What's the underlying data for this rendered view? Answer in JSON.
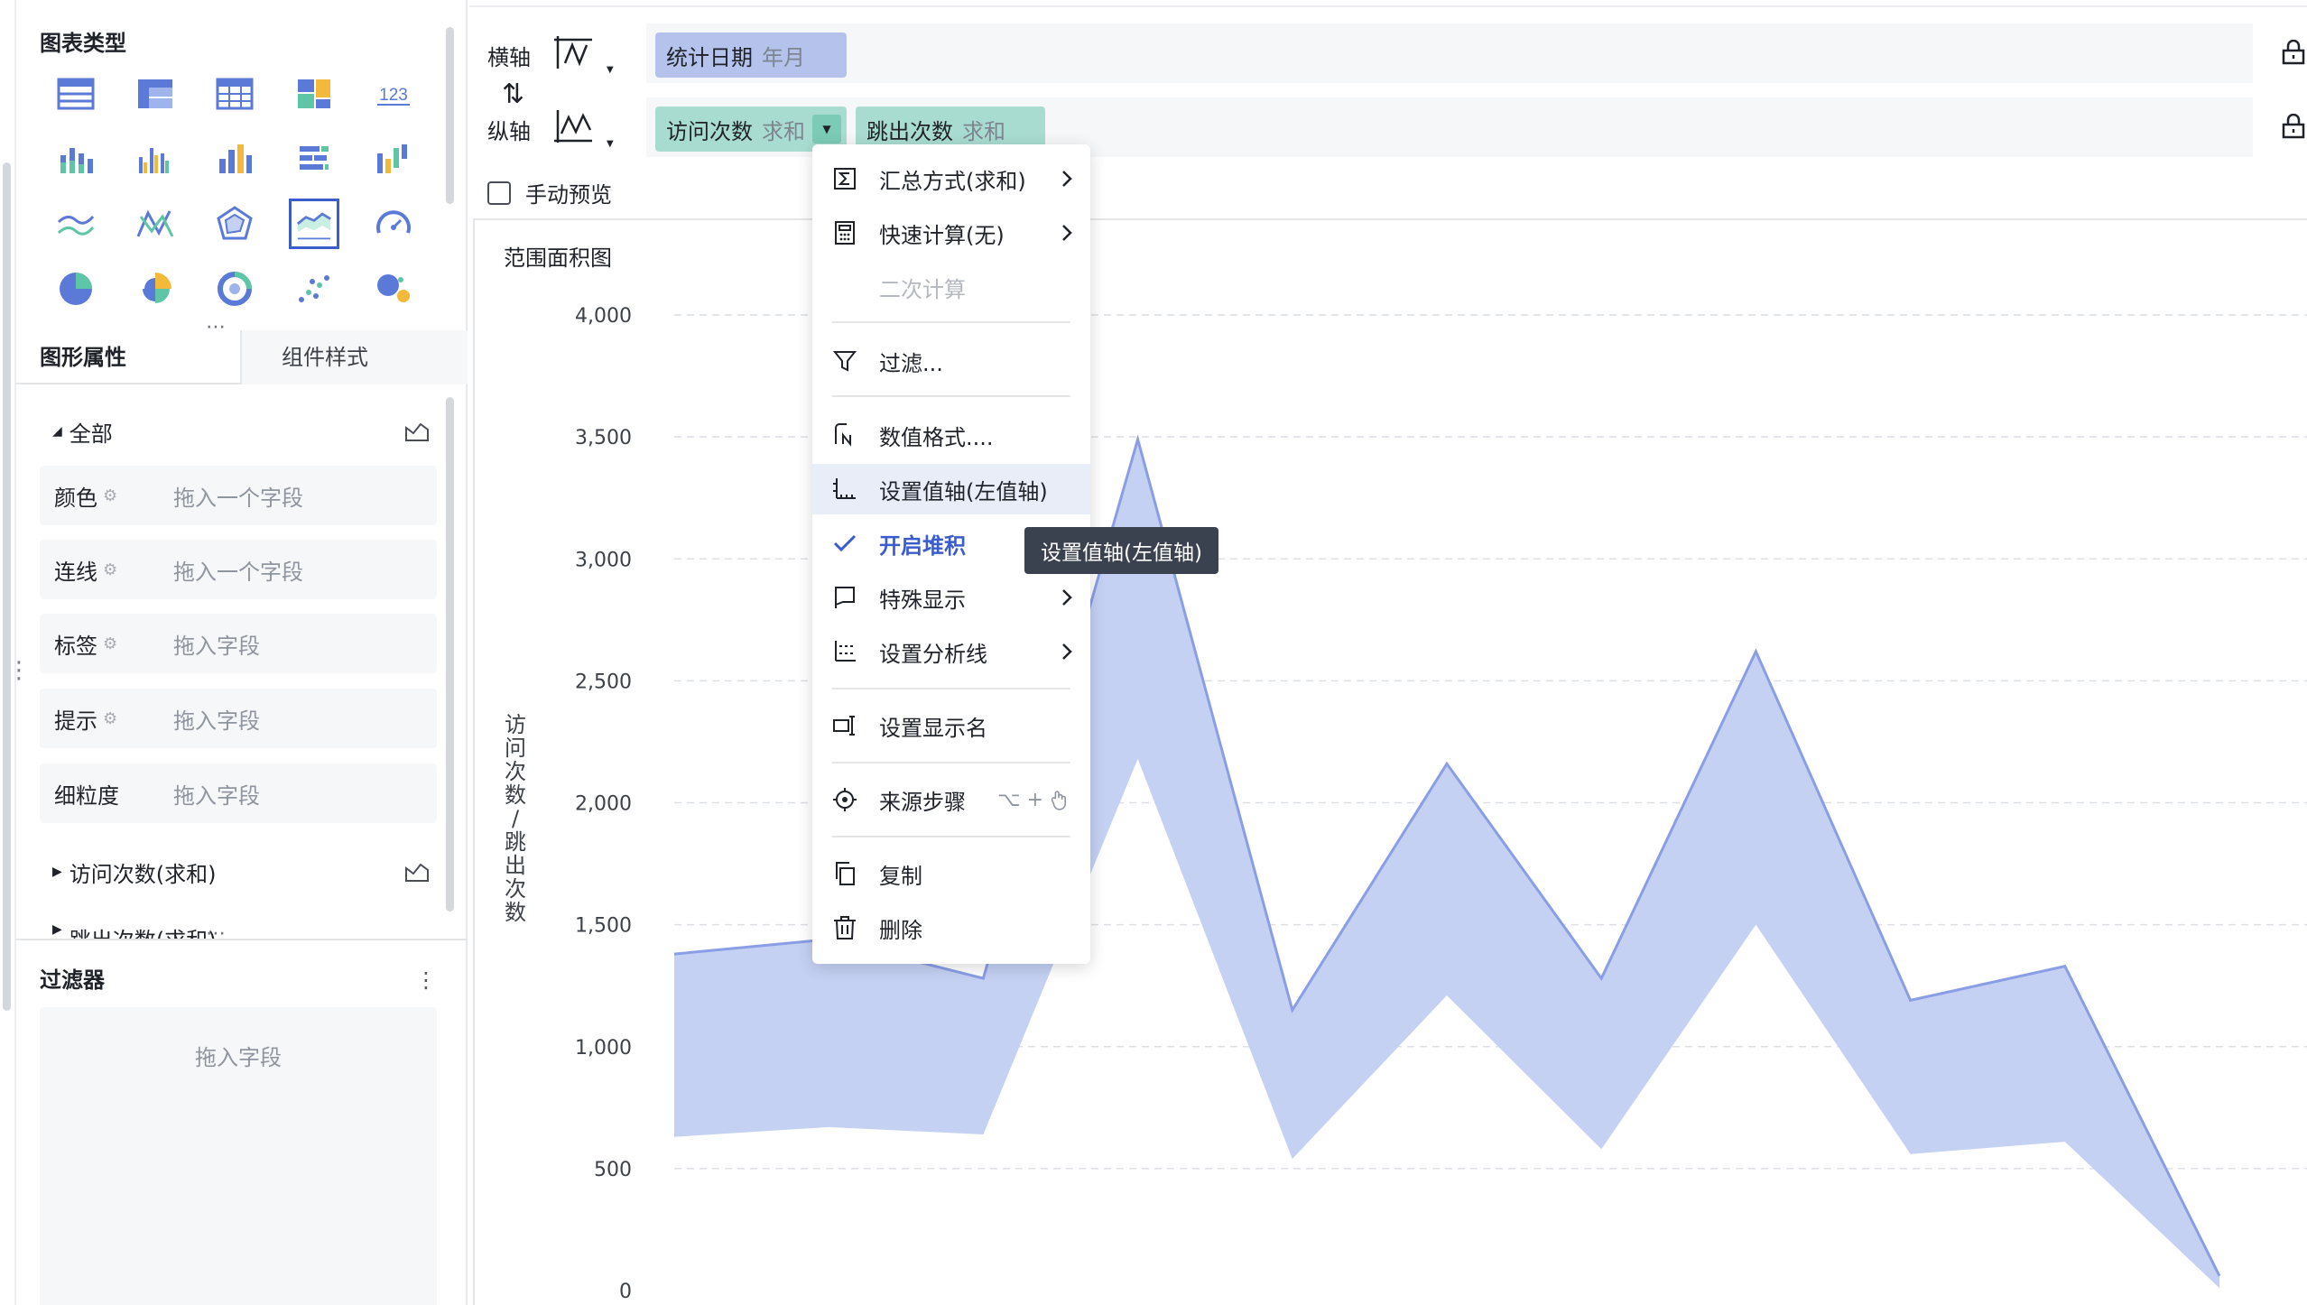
{
  "left_panel": {
    "chart_type_title": "图表类型",
    "chart_types": [
      {
        "name": "table-detail-icon"
      },
      {
        "name": "table-cross-icon"
      },
      {
        "name": "table-summary-icon"
      },
      {
        "name": "dashboard-tile-icon"
      },
      {
        "name": "kpi-number-icon",
        "text": "123"
      },
      {
        "name": "stacked-column-icon"
      },
      {
        "name": "grouped-column-icon"
      },
      {
        "name": "column-icon"
      },
      {
        "name": "bar-icon"
      },
      {
        "name": "waterfall-icon"
      },
      {
        "name": "line-icon"
      },
      {
        "name": "multi-line-icon"
      },
      {
        "name": "radar-icon"
      },
      {
        "name": "range-area-icon",
        "selected": true
      },
      {
        "name": "gauge-icon"
      },
      {
        "name": "pie-icon"
      },
      {
        "name": "rose-pie-icon"
      },
      {
        "name": "ring-icon"
      },
      {
        "name": "scatter-icon"
      },
      {
        "name": "bubble-icon"
      }
    ],
    "tabs": {
      "shape": "图形属性",
      "style": "组件样式"
    },
    "group_all": "全部",
    "fields": [
      {
        "label": "颜色",
        "placeholder": "拖入一个字段",
        "has_cog": true
      },
      {
        "label": "连线",
        "placeholder": "拖入一个字段",
        "has_cog": true
      },
      {
        "label": "标签",
        "placeholder": "拖入字段",
        "has_cog": true
      },
      {
        "label": "提示",
        "placeholder": "拖入字段",
        "has_cog": true
      },
      {
        "label": "细粒度",
        "placeholder": "拖入字段",
        "has_cog": false
      }
    ],
    "group_visits": "访问次数(求和)",
    "group_bounces": "跳出次数(求和)",
    "filter": {
      "title": "过滤器",
      "placeholder": "拖入字段"
    }
  },
  "shelves": {
    "x_axis": {
      "label": "横轴",
      "pill": {
        "name": "统计日期",
        "sub": "年月"
      }
    },
    "y_axis": {
      "label": "纵轴",
      "pills": [
        {
          "name": "访问次数",
          "sub": "求和"
        },
        {
          "name": "跳出次数",
          "sub": "求和"
        }
      ]
    }
  },
  "manual_preview": "手动预览",
  "chart_title": "范围面积图",
  "menu": {
    "items": [
      {
        "label": "汇总方式(求和)",
        "icon": "sigma-icon",
        "arrow": true
      },
      {
        "label": "快速计算(无)",
        "icon": "calculator-icon",
        "arrow": true
      },
      {
        "label": "二次计算",
        "disabled": true
      },
      {
        "label": "过滤...",
        "icon": "filter-icon"
      },
      {
        "label": "数值格式....",
        "icon": "number-format-icon"
      },
      {
        "label": "设置值轴(左值轴)",
        "icon": "axis-icon"
      },
      {
        "label": "开启堆积",
        "icon": "check-icon"
      },
      {
        "label": "特殊显示",
        "icon": "flag-icon",
        "arrow": true
      },
      {
        "label": "设置分析线",
        "icon": "analysis-line-icon",
        "arrow": true
      },
      {
        "label": "设置显示名",
        "icon": "rename-icon"
      },
      {
        "label": "来源步骤",
        "icon": "source-step-icon",
        "shortcut": "⌥ +"
      },
      {
        "label": "复制",
        "icon": "copy-icon"
      },
      {
        "label": "删除",
        "icon": "trash-icon"
      }
    ]
  },
  "tooltip": "设置值轴(左值轴)",
  "colors": {
    "accent": "#3a5ccc",
    "area_fill": "#c5d1f3",
    "area_stroke": "#8a9ee6",
    "dim_pill": "#b4c2ec",
    "measure_pill": "#a9dcd0"
  },
  "chart_data": {
    "type": "area",
    "subtype": "range-area",
    "title": "范围面积图",
    "ylabel": "访问次数/跳出次数",
    "xlabel": "",
    "ylim": [
      0,
      4000
    ],
    "y_ticks": [
      "0",
      "500",
      "1,000",
      "1,500",
      "2,000",
      "2,500",
      "3,000",
      "3,500",
      "4,000"
    ],
    "grid": true,
    "series": [
      {
        "name": "访问次数",
        "values": [
          1380,
          1440,
          1280,
          3490,
          1150,
          2160,
          1280,
          2620,
          1190,
          1330,
          60
        ]
      },
      {
        "name": "跳出次数",
        "values": [
          630,
          670,
          640,
          2180,
          540,
          1210,
          580,
          1500,
          560,
          610,
          10
        ]
      }
    ]
  }
}
